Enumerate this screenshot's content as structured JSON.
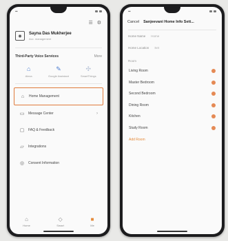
{
  "left": {
    "profile_name": "Sayna Das Mukherjee",
    "profile_sub": "Acc. management",
    "services_title": "Third-Party Voice Services",
    "services_aux": "More",
    "services": [
      {
        "icon": "alexa-icon",
        "label": "Alexa"
      },
      {
        "icon": "google-icon",
        "label": "Google Assistant"
      },
      {
        "icon": "smartthings-icon",
        "label": "SmartThings"
      }
    ],
    "menu": [
      {
        "icon": "home-management-icon",
        "label": "Home Management"
      },
      {
        "icon": "message-center-icon",
        "label": "Message Center"
      },
      {
        "icon": "faq-icon",
        "label": "FAQ & Feedback"
      },
      {
        "icon": "more-services-icon",
        "label": "Integrations"
      },
      {
        "icon": "privacy-icon",
        "label": "Consent Information"
      }
    ],
    "tabs": [
      "Home",
      "Smart",
      "Me"
    ]
  },
  "right": {
    "nav_back": "Cancel",
    "nav_title": "Sanjeevani Home Info Sett...",
    "fields": [
      {
        "label": "Home Name",
        "value": "Home"
      },
      {
        "label": "Home Location",
        "value": "Set"
      }
    ],
    "rooms_label": "Room",
    "rooms": [
      "Living Room",
      "Master Bedroom",
      "Second Bedroom",
      "Dining Room",
      "Kitchen",
      "Study Room"
    ],
    "add_room": "Add Room"
  },
  "colors": {
    "accent": "#e58a3a",
    "delete": "#e58a55",
    "service_blue": "#4a7bd0"
  }
}
